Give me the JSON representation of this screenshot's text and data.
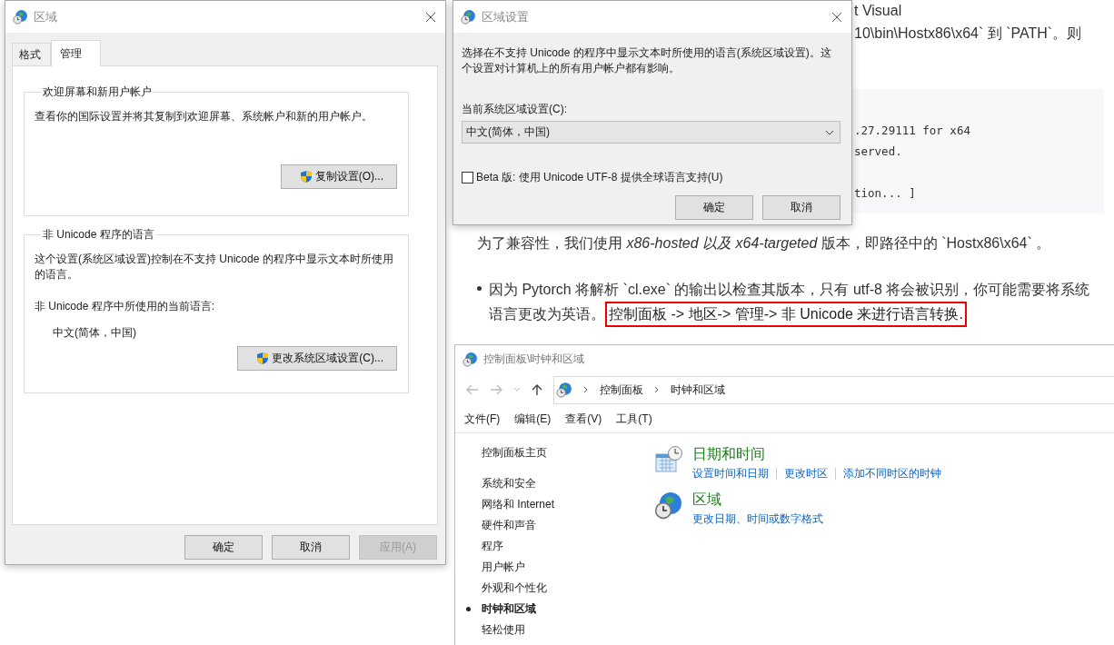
{
  "article": {
    "fragments": [
      "t Visual",
      "10\\bin\\Hostx86\\x64` 到 `PATH`。则"
    ],
    "code_lines": [
      ".27.29111 for x64",
      "served.",
      "tion... ]"
    ],
    "paragraph": "为了兼容性，我们使用 *x86-hosted 以及 x64-targeted* 版本，即路径中的 `Hostx86\\x64` 。",
    "bullet": {
      "text": "因为 Pytorch 将解析 `cl.exe` 的输出以检查其版本，只有 utf-8 将会被识别，你可能需要将系统语言更改为英语。",
      "highlight": "控制面板 -> 地区-> 管理-> 非 Unicode 来进行语言转换."
    }
  },
  "control_panel": {
    "title": "控制面板\\时钟和区域",
    "breadcrumb": [
      "控制面板",
      "时钟和区域"
    ],
    "menu": [
      "文件(F)",
      "编辑(E)",
      "查看(V)",
      "工具(T)"
    ],
    "home_link": "控制面板主页",
    "nav": [
      {
        "label": "系统和安全",
        "selected": false
      },
      {
        "label": "网络和 Internet",
        "selected": false
      },
      {
        "label": "硬件和声音",
        "selected": false
      },
      {
        "label": "程序",
        "selected": false
      },
      {
        "label": "用户帐户",
        "selected": false
      },
      {
        "label": "外观和个性化",
        "selected": false
      },
      {
        "label": "时钟和区域",
        "selected": true
      },
      {
        "label": "轻松使用",
        "selected": false
      }
    ],
    "categories": [
      {
        "kind": "date-time",
        "title": "日期和时间",
        "links": [
          "设置时间和日期",
          "更改时区",
          "添加不同时区的时钟"
        ]
      },
      {
        "kind": "region",
        "title": "区域",
        "links": [
          "更改日期、时间或数字格式"
        ]
      }
    ]
  },
  "region_dialog": {
    "title": "区域",
    "tabs": [
      {
        "label": "格式",
        "selected": false
      },
      {
        "label": "管理",
        "selected": true
      }
    ],
    "groups": [
      {
        "title": "欢迎屏幕和新用户帐户",
        "description": "查看你的国际设置并将其复制到欢迎屏幕、系统帐户和新的用户帐户。",
        "button": "复制设置(O)..."
      },
      {
        "title": "非 Unicode 程序的语言",
        "description": "这个设置(系统区域设置)控制在不支持 Unicode 的程序中显示文本时所使用的语言。",
        "label": "非 Unicode 程序中所使用的当前语言:",
        "value": "中文(简体，中国)",
        "button": "更改系统区域设置(C)..."
      }
    ],
    "buttons": [
      {
        "label": "确定",
        "disabled": false
      },
      {
        "label": "取消",
        "disabled": false
      },
      {
        "label": "应用(A)",
        "disabled": true
      }
    ]
  },
  "locale_dialog": {
    "title": "区域设置",
    "description": "选择在不支持 Unicode 的程序中显示文本时所使用的语言(系统区域设置)。这个设置对计算机上的所有用户帐户都有影响。",
    "label": "当前系统区域设置(C):",
    "selected_value": "中文(简体，中国)",
    "checkbox": {
      "label": "Beta 版: 使用 Unicode UTF-8 提供全球语言支持(U)",
      "checked": false
    },
    "buttons": [
      "确定",
      "取消"
    ]
  }
}
